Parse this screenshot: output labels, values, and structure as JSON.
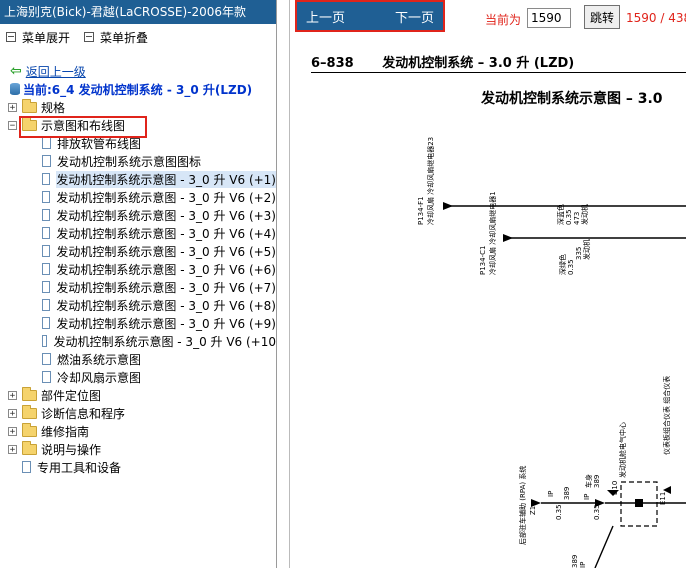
{
  "left_panel": {
    "title": "上海别克(Bick)-君越(LaCROSSE)-2006年款",
    "expand_label": "菜单展开",
    "collapse_label": "菜单折叠",
    "back_label": "返回上一级",
    "current_label": "当前:6_4 发动机控制系统 - 3_0 升(LZD)",
    "tree": [
      {
        "label": "规格",
        "type": "folder",
        "level": 0
      },
      {
        "label": "示意图和布线图",
        "type": "folder",
        "level": 0,
        "open": true
      },
      {
        "label": "排放软管布线图",
        "type": "page",
        "level": 1
      },
      {
        "label": "发动机控制系统示意图图标",
        "type": "page",
        "level": 1
      },
      {
        "label": "发动机控制系统示意图 - 3_0 升 V6 (+1)",
        "type": "page",
        "level": 1,
        "selected": true
      },
      {
        "label": "发动机控制系统示意图 - 3_0 升 V6 (+2)",
        "type": "page",
        "level": 1
      },
      {
        "label": "发动机控制系统示意图 - 3_0 升 V6 (+3)",
        "type": "page",
        "level": 1
      },
      {
        "label": "发动机控制系统示意图 - 3_0 升 V6 (+4)",
        "type": "page",
        "level": 1
      },
      {
        "label": "发动机控制系统示意图 - 3_0 升 V6 (+5)",
        "type": "page",
        "level": 1
      },
      {
        "label": "发动机控制系统示意图 - 3_0 升 V6 (+6)",
        "type": "page",
        "level": 1
      },
      {
        "label": "发动机控制系统示意图 - 3_0 升 V6 (+7)",
        "type": "page",
        "level": 1
      },
      {
        "label": "发动机控制系统示意图 - 3_0 升 V6 (+8)",
        "type": "page",
        "level": 1
      },
      {
        "label": "发动机控制系统示意图 - 3_0 升 V6 (+9)",
        "type": "page",
        "level": 1
      },
      {
        "label": "发动机控制系统示意图 - 3_0 升 V6 (+10",
        "type": "page",
        "level": 1
      },
      {
        "label": "燃油系统示意图",
        "type": "page",
        "level": 1
      },
      {
        "label": "冷却风扇示意图",
        "type": "page",
        "level": 1
      },
      {
        "label": "部件定位图",
        "type": "folder",
        "level": 0
      },
      {
        "label": "诊断信息和程序",
        "type": "folder",
        "level": 0
      },
      {
        "label": "维修指南",
        "type": "folder",
        "level": 0
      },
      {
        "label": "说明与操作",
        "type": "folder",
        "level": 0
      },
      {
        "label": "专用工具和设备",
        "type": "page",
        "level": 0
      }
    ]
  },
  "toolbar": {
    "prev_label": "上一页",
    "next_label": "下一页",
    "current_page_label": "当前为",
    "page_value": "1590",
    "jump_label": "跳转",
    "page_count": "1590 / 438"
  },
  "document": {
    "section": "6–838",
    "header_title": "发动机控制系统 – 3.0 升 (LZD)",
    "diagram_title": "发动机控制系统示意图 – 3.0",
    "labels": {
      "fan1": "冷却风扇\n冷却风扇继电器23",
      "fan1_conn": "P134-F1",
      "wire1_color": "深蓝色",
      "wire1_gauge": "0.35",
      "wire1_circuit": "473",
      "wire1_tag": "发动机",
      "fan2": "冷却风扇\n冷却风扇继电器1",
      "fan2_conn": "P134-C1",
      "wire2_color": "深绿色",
      "wire2_gauge": "0.35",
      "wire2_circuit": "335",
      "wire2_tag": "发动机",
      "ipa": "后部驻车辅助 (RPA) 系统",
      "ipa_conn": "Z1",
      "ip1": "IP",
      "ip1_gauge": "0.35",
      "ip1_circuit": "389",
      "ip2": "IP",
      "ip2_gauge": "0.35",
      "ip2_tag": "车身",
      "ip2_circuit": "389",
      "center": "发动机舱电气中心",
      "d10": "D10",
      "instrument": "仪表板组合仪表\n组合仪表",
      "e11": "E11",
      "bottom_circuit": "389",
      "bottom_ip": "IP"
    }
  }
}
